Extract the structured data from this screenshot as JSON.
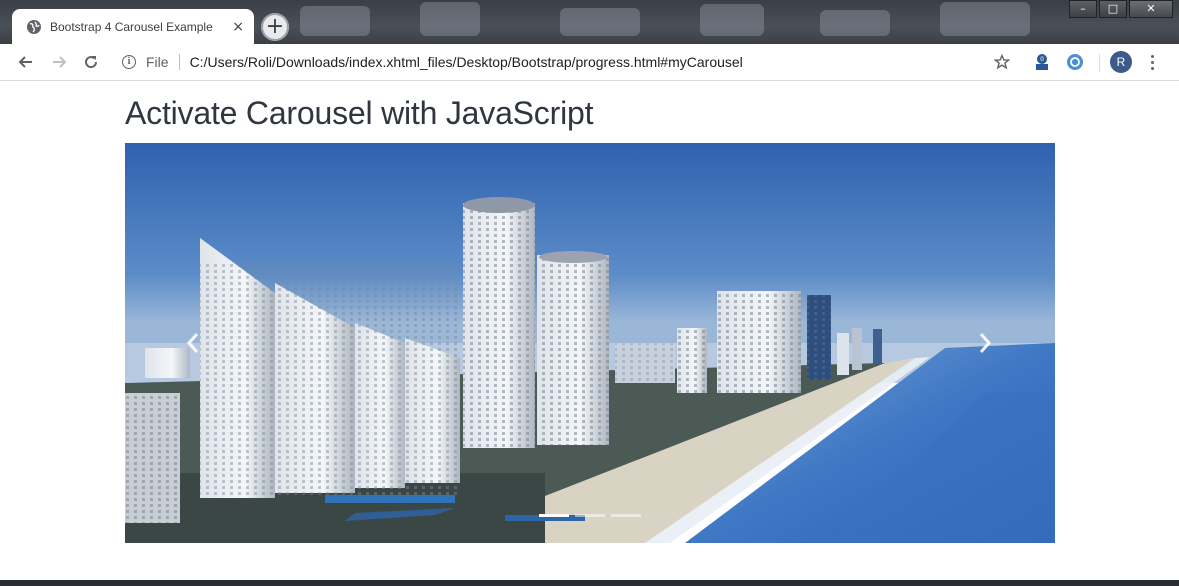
{
  "browser": {
    "tab_title": "Bootstrap 4 Carousel Example",
    "tab_close": "×",
    "new_tab": "+",
    "omnibox": {
      "scheme_label": "File",
      "url": "C:/Users/Roli/Downloads/index.xhtml_files/Desktop/Bootstrap/progress.html#myCarousel"
    },
    "profile_initial": "R",
    "window_controls": {
      "minimize": "–",
      "maximize": "□",
      "close": "✕"
    }
  },
  "page": {
    "heading": "Activate Carousel with JavaScript",
    "carousel": {
      "active_slide_index": 0,
      "slide_count": 3,
      "slide_image": "Aerial view of beachfront high-rise towers along the ocean",
      "prev_icon": "chevron-left-icon",
      "next_icon": "chevron-right-icon"
    }
  },
  "colors": {
    "sky": "#3f6fb8",
    "ocean": "#3f77c4",
    "heading": "#2f3640",
    "tab_bg": "#ffffff"
  }
}
